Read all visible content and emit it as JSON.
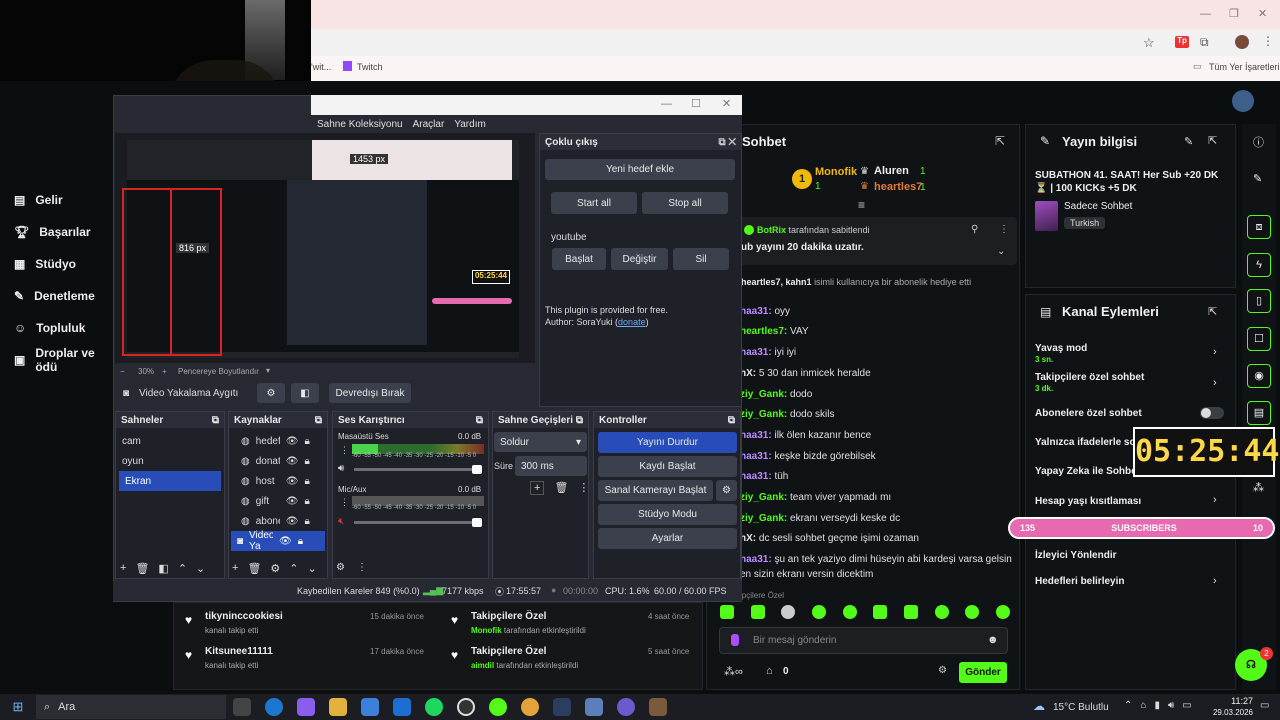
{
  "browser": {
    "bookmark_twitch": "Twitch",
    "bookmark_prefix": "'wit...",
    "all_bookmarks": "Tüm Yer İşaretleri"
  },
  "kick_sidebar": {
    "items": [
      {
        "label": "Gelir",
        "icon": "money-icon"
      },
      {
        "label": "Başarılar",
        "icon": "trophy-icon"
      },
      {
        "label": "Stüdyo",
        "icon": "studio-icon"
      },
      {
        "label": "Denetleme",
        "icon": "wrench-icon"
      },
      {
        "label": "Topluluk",
        "icon": "community-icon"
      },
      {
        "label": "Droplar ve ödü",
        "icon": "drops-icon"
      }
    ]
  },
  "obs": {
    "menu": [
      "Sahne Koleksiyonu",
      "Araçlar",
      "Yardım"
    ],
    "preview_px_label": "1453 px",
    "preview_px_label2": "816 px",
    "preview_clock": "05:25:44",
    "zoom": "30%",
    "resize_label": "Pencereye Boyutlandır",
    "source_name": "Video Yakalama Aygıtı",
    "deactivate": "Devredışı Bırak",
    "multi_output": {
      "title": "Çoklu çıkış",
      "add_target": "Yeni hedef ekle",
      "start_all": "Start all",
      "stop_all": "Stop all",
      "target_name": "youtube",
      "start": "Başlat",
      "edit": "Değiştir",
      "delete": "Sil",
      "free_text": "This plugin is provided for free.",
      "author": "Author: SoraYuki (",
      "donate": "donate",
      "author_end": ")"
    },
    "scenes": {
      "title": "Sahneler",
      "items": [
        "cam",
        "oyun",
        "Ekran"
      ]
    },
    "sources": {
      "title": "Kaynaklar",
      "items": [
        "hedef",
        "donat",
        "host",
        "gift",
        "abone",
        "Video Ya"
      ]
    },
    "mixer": {
      "title": "Ses Karıştırıcı",
      "ch1": "Masaüstü Ses",
      "ch1_db": "0.0 dB",
      "ch2": "Mic/Aux",
      "ch2_db": "0.0 dB",
      "scale": "-60 -55 -50 -45 -40 -35 -30 -25 -20 -15 -10 -5 0"
    },
    "transitions": {
      "title": "Sahne Geçişleri",
      "type": "Soldur",
      "duration_label": "Süre",
      "duration": "300 ms"
    },
    "controls": {
      "title": "Kontroller",
      "stop_stream": "Yayını Durdur",
      "start_record": "Kaydı Başlat",
      "virtual_cam": "Sanal Kamerayı Başlat",
      "studio_mode": "Stüdyo Modu",
      "settings": "Ayarlar"
    },
    "status": {
      "dropped": "Kaybedilen Kareler 849 (%0.0)",
      "kbps": "7177 kbps",
      "stream_time": "17:55:57",
      "rec_time": "00:00:00",
      "cpu": "CPU: 1.6%",
      "fps": "60.00 / 60.00 FPS"
    }
  },
  "activity": {
    "left": [
      {
        "user": "tikyninccookiesi",
        "text": "kanalı takip etti",
        "time": "15 dakika önce"
      },
      {
        "user": "Kitsunee11111",
        "text": "kanalı takip etti",
        "time": "17 dakika önce"
      }
    ],
    "right": [
      {
        "title": "Takipçilere Özel",
        "user": "Monofik",
        "text": "tarafından etkinleştirildi",
        "time": "4 saat önce"
      },
      {
        "title": "Takipçilere Özel",
        "user": "aimdil",
        "text": "tarafından etkinleştirildi",
        "time": "5 saat önce"
      }
    ]
  },
  "chat": {
    "title": "Sohbet",
    "top1_name": "Monofik",
    "top1_count": "1",
    "top2_name": "Aluren",
    "top2_count": "1",
    "top3_name": "heartles7",
    "top3_count": "1",
    "top_rank": "1",
    "pinned_by": "BotRix",
    "pinned_by_suffix": "tarafından sabitlendi",
    "pinned_text": "ub yayını 20 dakika uzatır.",
    "gift_line_users": "heartles7, kahn1",
    "gift_line_text": "isimli kullanıcıya bir abonelik hediye etti",
    "messages": [
      {
        "user": "haa31:",
        "text": "oyy",
        "color": "#b98cff"
      },
      {
        "user": "heartles7:",
        "text": "VAY",
        "color": "#53fc18"
      },
      {
        "user": "haa31:",
        "text": "iyi iyi",
        "color": "#b98cff"
      },
      {
        "user": "hX:",
        "text": "5 30 dan inmicek heralde",
        "color": "#e8e8e8"
      },
      {
        "user": "ziy_Gank:",
        "text": "dodo",
        "color": "#53fc18"
      },
      {
        "user": "ziy_Gank:",
        "text": "dodo skils",
        "color": "#53fc18"
      },
      {
        "user": "haa31:",
        "text": "ilk ölen kazanır bence",
        "color": "#b98cff"
      },
      {
        "user": "haa31:",
        "text": "keşke bizde görebilsek",
        "color": "#b98cff"
      },
      {
        "user": "haa31:",
        "text": "tüh",
        "color": "#b98cff"
      },
      {
        "user": "ziy_Gank:",
        "text": "team viver yapmadı mı",
        "color": "#53fc18"
      },
      {
        "user": "ziy_Gank:",
        "text": "ekranı verseydi keske dc",
        "color": "#53fc18"
      },
      {
        "user": "hX:",
        "text": "dc sesli sohbet geçme işimi ozaman",
        "color": "#e8e8e8"
      },
      {
        "user": "haa31:",
        "text": "şu an tek yaziyo dimi hüseyin abi kardeşi varsa gelsin",
        "color": "#b98cff"
      }
    ],
    "msg_continuation": "en sizin ekranı versin dicektim",
    "followers_only": "ipçilere Özel",
    "input_placeholder": "Bir mesaj gönderin",
    "points": "0",
    "send": "Gönder"
  },
  "stream_info": {
    "title": "Yayın bilgisi",
    "stream_title": "SUBATHON 41. SAAT! Her Sub +20 DK ⏳ | 100 KICKs +5 DK",
    "category": "Sadece Sohbet",
    "language": "Turkish"
  },
  "channel_actions": {
    "title": "Kanal Eylemleri",
    "slow_mode": "Yavaş mod",
    "slow_mode_value": "3 sn.",
    "followers_chat": "Takipçilere özel sohbet",
    "followers_chat_value": "3 dk.",
    "subs_chat": "Abonelere özel sohbet",
    "emotes_only": "Yalnızca ifadelerle so",
    "ai_chat": "Yapay Zeka ile Sohbet",
    "age_restrict": "Hesap yaşı kısıtlaması",
    "redirect": "İzleyici Yönlendir",
    "goals": "Hedefleri belirleyin"
  },
  "overlay": {
    "timer": "05:25:44",
    "subs_left": "135",
    "subs_label": "SUBSCRIBERS",
    "subs_right": "10"
  },
  "taskbar": {
    "search": "Ara",
    "weather": "15°C  Bulutlu",
    "time": "11:27",
    "date": "29.03.2026",
    "badge": "2"
  },
  "colors": {
    "kick_green": "#53fc18",
    "obs_blue": "#284cb8",
    "overlay_pink": "#e56ab0",
    "timer_yellow": "#ffd84a"
  }
}
